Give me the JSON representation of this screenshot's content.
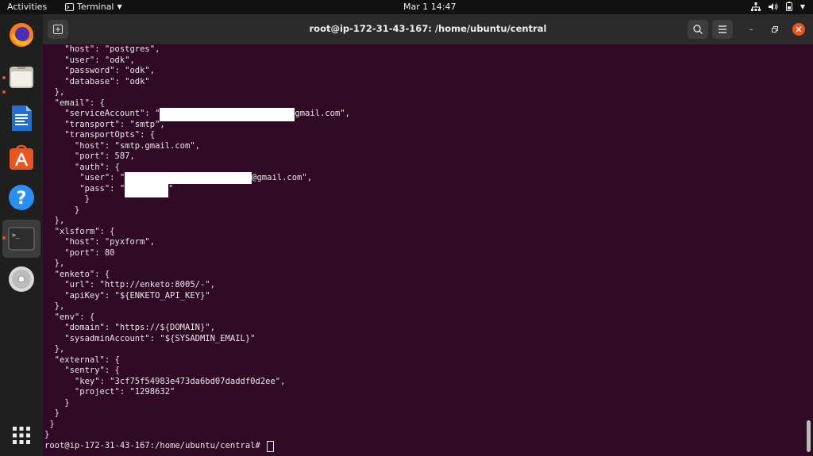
{
  "topbar": {
    "activities": "Activities",
    "app_name": "Terminal",
    "clock": "Mar 1  14:47",
    "icons": [
      "network-icon",
      "volume-icon",
      "battery-icon",
      "system-menu-chevron-icon"
    ]
  },
  "dock": {
    "apps": [
      "Firefox",
      "Files",
      "LibreOffice Writer",
      "Ubuntu Software",
      "Help",
      "Terminal",
      "Disc"
    ]
  },
  "window": {
    "title": "root@ip-172-31-43-167: /home/ubuntu/central"
  },
  "terminal": {
    "lines": [
      "    \"host\": \"postgres\",",
      "    \"user\": \"odk\",",
      "    \"password\": \"odk\",",
      "    \"database\": \"odk\"",
      "  },",
      "  \"email\": {",
      "    \"serviceAccount\": \"",
      "    \"transport\": \"smtp\",",
      "    \"transportOpts\": {",
      "      \"host\": \"smtp.gmail.com\",",
      "      \"port\": 587,",
      "      \"auth\": {",
      "       \"user\": \"",
      "       \"pass\": \"",
      "        }",
      "      }",
      "  },",
      "  \"xlsform\": {",
      "    \"host\": \"pyxform\",",
      "    \"port\": 80",
      "  },",
      "  \"enketo\": {",
      "    \"url\": \"http://enketo:8005/-\",",
      "    \"apiKey\": \"${ENKETO_API_KEY}\"",
      "  },",
      "  \"env\": {",
      "    \"domain\": \"https://${DOMAIN}\",",
      "    \"sysadminAccount\": \"${SYSADMIN_EMAIL}\"",
      "  },",
      "  \"external\": {",
      "    \"sentry\": {",
      "      \"key\": \"3cf75f54983e473da6bd07daddf0d2ee\",",
      "      \"project\": \"1298632\"",
      "    }",
      "  }",
      " }",
      "}"
    ],
    "service_account_suffix": "gmail.com\",",
    "user_suffix": "@gmail.com\",",
    "pass_suffix": "\"",
    "prompt": "root@ip-172-31-43-167:/home/ubuntu/central# "
  }
}
